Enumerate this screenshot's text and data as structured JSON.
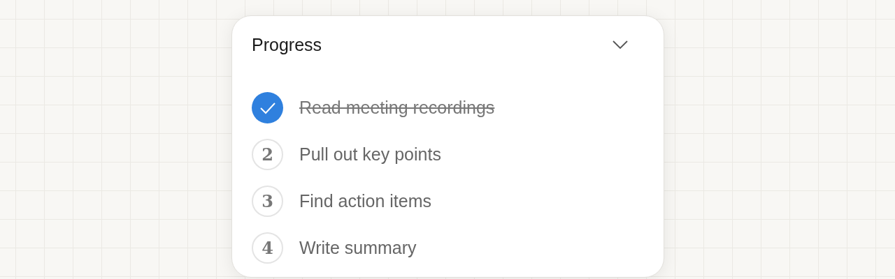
{
  "panel": {
    "title": "Progress",
    "expanded": true
  },
  "steps": [
    {
      "label": "Read meeting recordings",
      "done": true
    },
    {
      "label": "Pull out key points",
      "done": false,
      "number": "2"
    },
    {
      "label": "Find action items",
      "done": false,
      "number": "3"
    },
    {
      "label": "Write summary",
      "done": false,
      "number": "4"
    }
  ]
}
